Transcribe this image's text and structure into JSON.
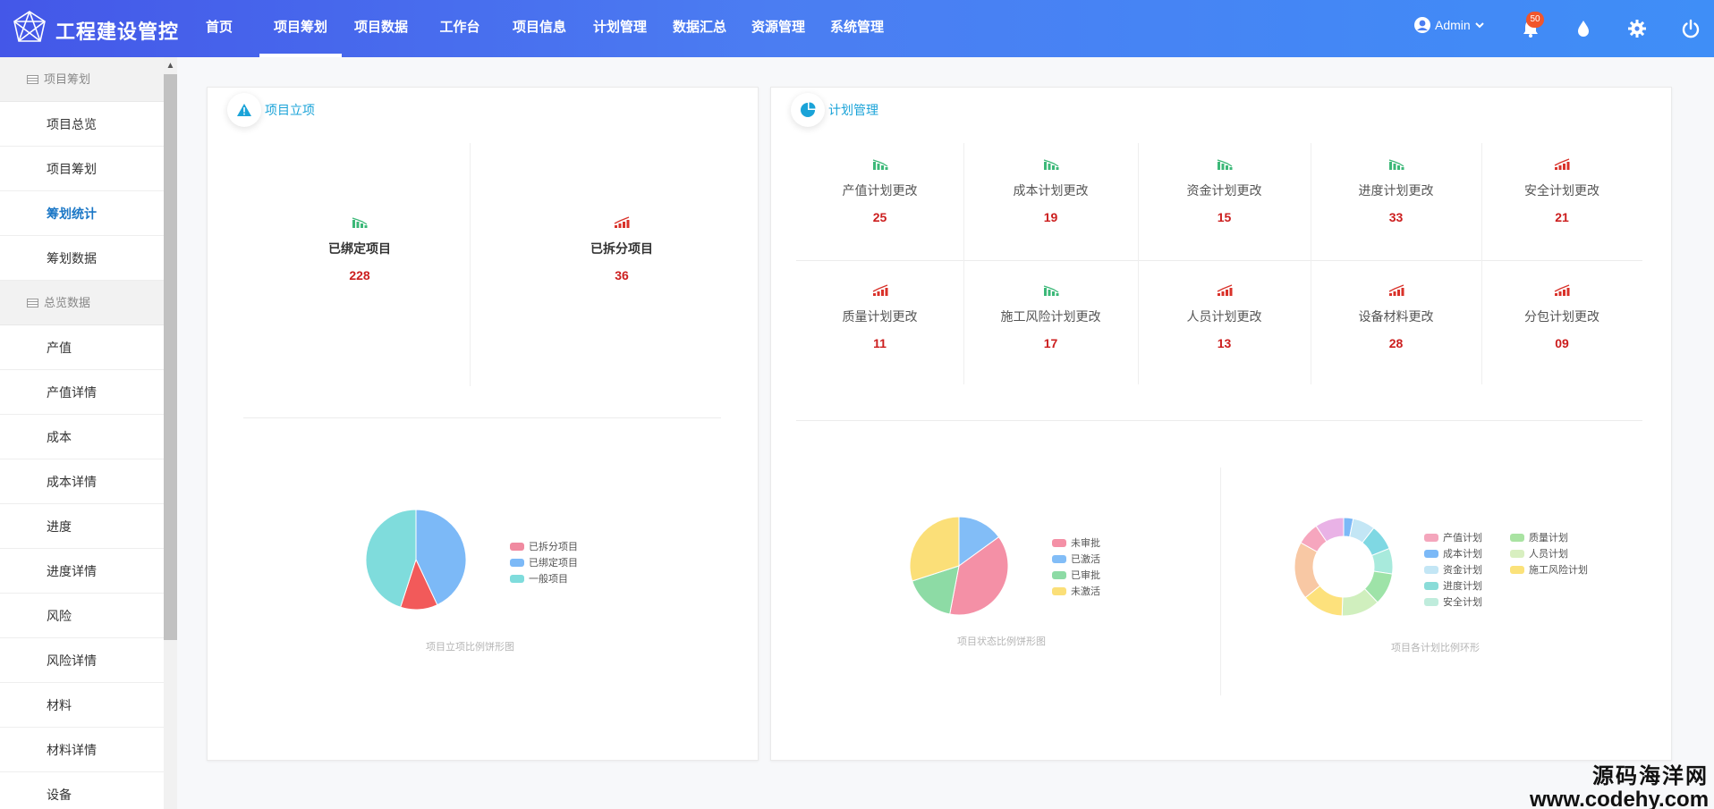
{
  "app": {
    "title": "工程建设管控"
  },
  "nav": [
    {
      "label": "首页"
    },
    {
      "label": "项目筹划",
      "active": true
    },
    {
      "label": "项目数据"
    },
    {
      "label": "工作台"
    },
    {
      "label": "项目信息"
    },
    {
      "label": "计划管理"
    },
    {
      "label": "数据汇总"
    },
    {
      "label": "资源管理"
    },
    {
      "label": "系统管理"
    }
  ],
  "header": {
    "user_label": "Admin",
    "notification_count": "50",
    "icons": [
      "user-icon",
      "bell-icon",
      "water-drop-icon",
      "gear-icon",
      "power-icon"
    ]
  },
  "sidebar": {
    "groups": [
      {
        "label": "项目筹划",
        "items": [
          {
            "label": "项目总览"
          },
          {
            "label": "项目筹划"
          },
          {
            "label": "筹划统计",
            "active": true
          },
          {
            "label": "筹划数据"
          }
        ]
      },
      {
        "label": "总览数据",
        "items": [
          {
            "label": "产值"
          },
          {
            "label": "产值详情"
          },
          {
            "label": "成本"
          },
          {
            "label": "成本详情"
          },
          {
            "label": "进度"
          },
          {
            "label": "进度详情"
          },
          {
            "label": "风险"
          },
          {
            "label": "风险详情"
          },
          {
            "label": "材料"
          },
          {
            "label": "材料详情"
          },
          {
            "label": "设备"
          }
        ]
      }
    ]
  },
  "project_card": {
    "title": "项目立项",
    "stats": [
      {
        "label": "已绑定项目",
        "value": "228",
        "trend": "down",
        "color": "#3cb878"
      },
      {
        "label": "已拆分项目",
        "value": "36",
        "trend": "up",
        "color": "#d9322a"
      }
    ],
    "chart_caption": "项目立项比例饼形图"
  },
  "plan_card": {
    "title": "计划管理",
    "stats": [
      {
        "label": "产值计划更改",
        "value": "25",
        "trend": "down",
        "color": "#3cb878"
      },
      {
        "label": "成本计划更改",
        "value": "19",
        "trend": "down",
        "color": "#3cb878"
      },
      {
        "label": "资金计划更改",
        "value": "15",
        "trend": "down",
        "color": "#3cb878"
      },
      {
        "label": "进度计划更改",
        "value": "33",
        "trend": "down",
        "color": "#3cb878"
      },
      {
        "label": "安全计划更改",
        "value": "21",
        "trend": "up",
        "color": "#d9322a"
      },
      {
        "label": "质量计划更改",
        "value": "11",
        "trend": "up",
        "color": "#d9322a"
      },
      {
        "label": "施工风险计划更改",
        "value": "17",
        "trend": "down",
        "color": "#3cb878"
      },
      {
        "label": "人员计划更改",
        "value": "13",
        "trend": "up",
        "color": "#d9322a"
      },
      {
        "label": "设备材料更改",
        "value": "28",
        "trend": "up",
        "color": "#d9322a"
      },
      {
        "label": "分包计划更改",
        "value": "09",
        "trend": "up",
        "color": "#d9322a"
      }
    ],
    "status_caption": "项目状态比例饼形图",
    "ring_caption": "项目各计划比例环形"
  },
  "chart_data": [
    {
      "type": "pie",
      "title": "项目立项比例饼形图",
      "categories": [
        "已拆分项目",
        "已绑定项目",
        "一般项目"
      ],
      "values": [
        12,
        43,
        45
      ],
      "slice_order": [
        "已绑定项目",
        "已拆分项目",
        "一般项目"
      ],
      "colors": {
        "已拆分项目": "#f25a5a",
        "已绑定项目": "#7cb9f7",
        "一般项目": "#7fdcdc"
      },
      "legend_colors": [
        "#f08aa0",
        "#7cb9f7",
        "#7fdcdc"
      ]
    },
    {
      "type": "pie",
      "title": "项目状态比例饼形图",
      "categories": [
        "未审批",
        "已激活",
        "已审批",
        "未激活"
      ],
      "values": [
        38,
        15,
        17,
        30
      ],
      "slice_order": [
        "已激活",
        "未审批",
        "已审批",
        "未激活"
      ],
      "colors": {
        "未审批": "#f490a6",
        "已激活": "#82bdf7",
        "已审批": "#8ddba5",
        "未激活": "#fbdf78"
      }
    },
    {
      "type": "pie",
      "subtype": "donut",
      "title": "项目各计划比例环形",
      "categories": [
        "产值计划",
        "成本计划",
        "资金计划",
        "进度计划",
        "安全计划",
        "质量计划",
        "人员计划",
        "施工风险计划"
      ],
      "legend_colors": [
        "#f4a6bc",
        "#7cb9f7",
        "#c3e6f5",
        "#8adcd8",
        "#bfecdc",
        "#a9e3a2",
        "#d8efc0",
        "#fbe27a"
      ],
      "ring_values": [
        3,
        7,
        8,
        8,
        10,
        12,
        13,
        18,
        7,
        9
      ],
      "ring_colors": [
        "#7cb9f7",
        "#c3e6f5",
        "#7fd8e3",
        "#a8eadc",
        "#9ee3a8",
        "#d0efbe",
        "#fde17c",
        "#f8c8a4",
        "#f6a6be",
        "#e9b2e6"
      ]
    }
  ]
}
